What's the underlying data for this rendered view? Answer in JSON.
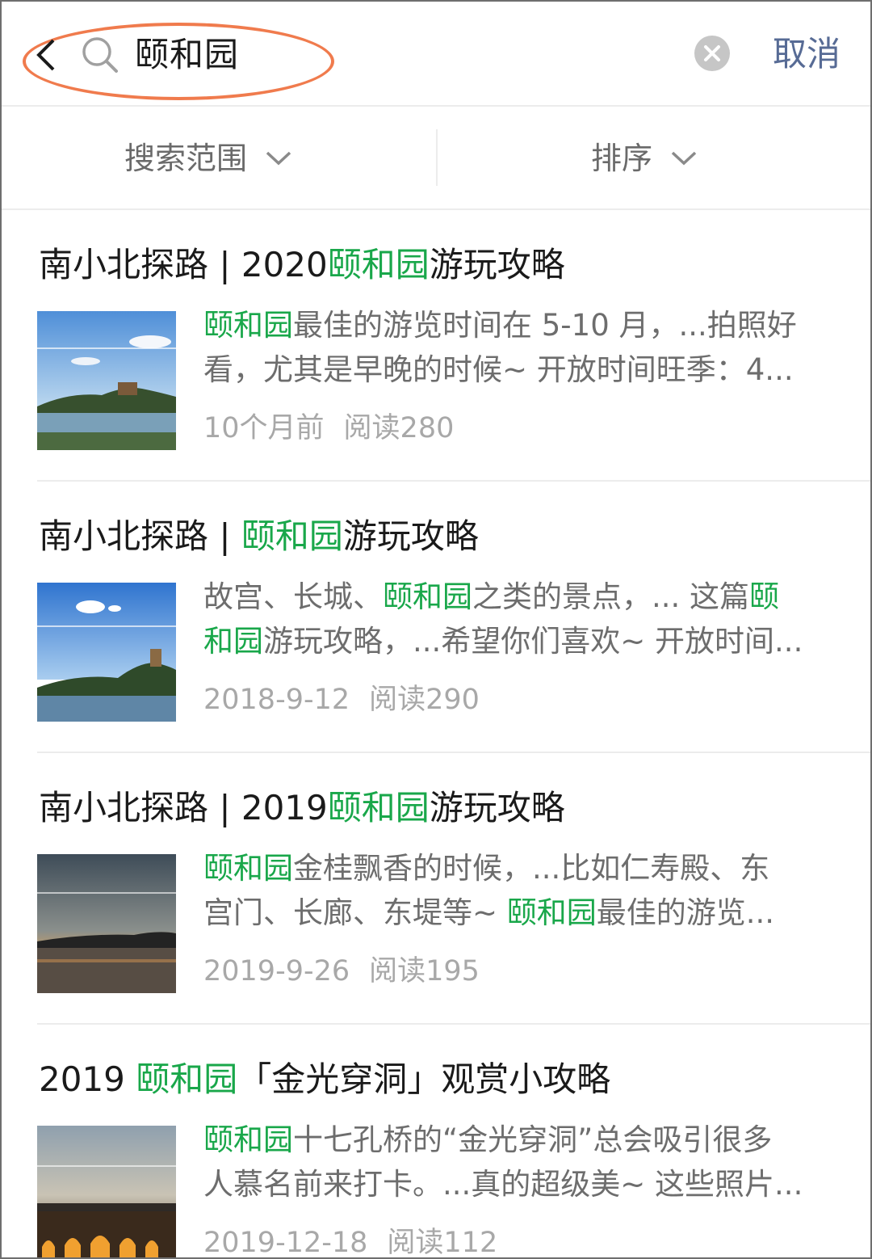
{
  "search": {
    "query": "颐和园",
    "cancel_label": "取消"
  },
  "filters": {
    "scope_label": "搜索范围",
    "sort_label": "排序"
  },
  "colors": {
    "highlight": "#19a74a",
    "link": "#576b95",
    "annotation_ring": "#f07b4d"
  },
  "results": [
    {
      "title": {
        "pre": "南小北探路 | 2020",
        "hl": "颐和园",
        "post": "游玩攻略"
      },
      "snippet": {
        "l1": [
          {
            "t": "颐和园",
            "h": true
          },
          {
            "t": "最佳的游览时间在 5-10 月，...拍照好",
            "h": false
          }
        ],
        "l2": [
          {
            "t": "看，尤其是早晚的时候~ 开放时间旺季：4...",
            "h": false
          }
        ]
      },
      "time": "10个月前",
      "reads": "阅读280"
    },
    {
      "title": {
        "pre": "南小北探路 | ",
        "hl": "颐和园",
        "post": "游玩攻略"
      },
      "snippet": {
        "l1": [
          {
            "t": "故宫、长城、",
            "h": false
          },
          {
            "t": "颐和园",
            "h": true
          },
          {
            "t": "之类的景点，... 这篇",
            "h": false
          },
          {
            "t": "颐",
            "h": true
          }
        ],
        "l2": [
          {
            "t": "和园",
            "h": true
          },
          {
            "t": "游玩攻略，...希望你们喜欢~ 开放时间...",
            "h": false
          }
        ]
      },
      "time": "2018-9-12",
      "reads": "阅读290"
    },
    {
      "title": {
        "pre": "南小北探路 | 2019",
        "hl": "颐和园",
        "post": "游玩攻略"
      },
      "snippet": {
        "l1": [
          {
            "t": "颐和园",
            "h": true
          },
          {
            "t": "金桂飘香的时候，...比如仁寿殿、东",
            "h": false
          }
        ],
        "l2": [
          {
            "t": "宫门、长廊、东堤等~ ",
            "h": false
          },
          {
            "t": "颐和园",
            "h": true
          },
          {
            "t": "最佳的游览...",
            "h": false
          }
        ]
      },
      "time": "2019-9-26",
      "reads": "阅读195"
    },
    {
      "title": {
        "pre": "2019 ",
        "hl": "颐和园",
        "post": "「金光穿洞」观赏小攻略"
      },
      "snippet": {
        "l1": [
          {
            "t": "颐和园",
            "h": true
          },
          {
            "t": "十七孔桥的“金光穿洞”总会吸引很多",
            "h": false
          }
        ],
        "l2": [
          {
            "t": "人慕名前来打卡。...真的超级美~ 这些照片...",
            "h": false
          }
        ]
      },
      "time": "2019-12-18",
      "reads": "阅读112"
    }
  ]
}
